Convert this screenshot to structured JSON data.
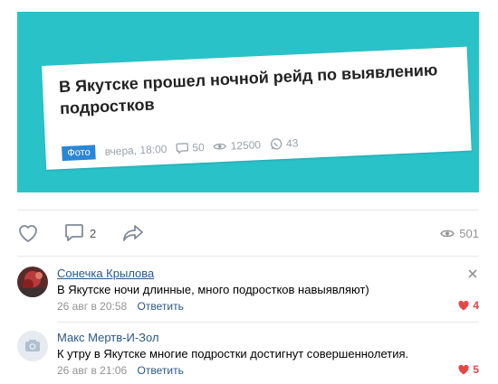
{
  "post": {
    "image_card": {
      "title": "В Якутске прошел ночной рейд по выявлению подростков",
      "badge": "Фото",
      "time": "вчера, 18:00",
      "comments": "50",
      "views": "12500",
      "shares": "43"
    }
  },
  "actions": {
    "comments_count": "2",
    "views_count": "501"
  },
  "comments": [
    {
      "author": "Сонечка Крылова",
      "text": "В Якутске ночи длинные, много подростков навыявляют)",
      "date": "26 авг в 20:58",
      "reply_label": "Ответить",
      "likes": "4"
    },
    {
      "author": "Макс Мертв-И-Зол",
      "text": "К утру в Якутске многие подростки достигнут совершеннолетия.",
      "date": "26 авг в 21:06",
      "reply_label": "Ответить",
      "likes": "5"
    }
  ],
  "colors": {
    "image_bg": "#2ac2c9",
    "link": "#2a5885",
    "like": "#e64646",
    "badge": "#2a87d3"
  }
}
